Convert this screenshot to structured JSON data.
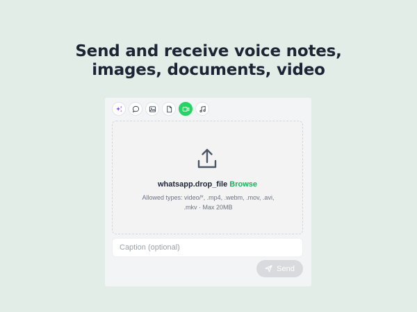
{
  "headline": {
    "line1": "Send and receive voice notes,",
    "line2": "images, documents, video"
  },
  "tabs": [
    {
      "name": "ai-sparkle-icon",
      "active": false
    },
    {
      "name": "chat-bubble-icon",
      "active": false
    },
    {
      "name": "image-icon",
      "active": false
    },
    {
      "name": "document-icon",
      "active": false
    },
    {
      "name": "video-camera-icon",
      "active": true
    },
    {
      "name": "music-note-icon",
      "active": false
    }
  ],
  "dropzone": {
    "icon": "upload-icon",
    "drop_text": "whatsapp.drop_file",
    "browse_label": "Browse",
    "allowed_line1": "Allowed types: video/*, .mp4, .webm, .mov, .avi,",
    "allowed_line2": ".mkv · Max 20MB"
  },
  "caption": {
    "placeholder": "Caption (optional)",
    "value": ""
  },
  "send": {
    "label": "Send",
    "icon": "send-icon"
  },
  "colors": {
    "background": "#e3ede8",
    "accent": "#25d366",
    "browse": "#1fae5b",
    "send_disabled": "#d9dadd"
  }
}
